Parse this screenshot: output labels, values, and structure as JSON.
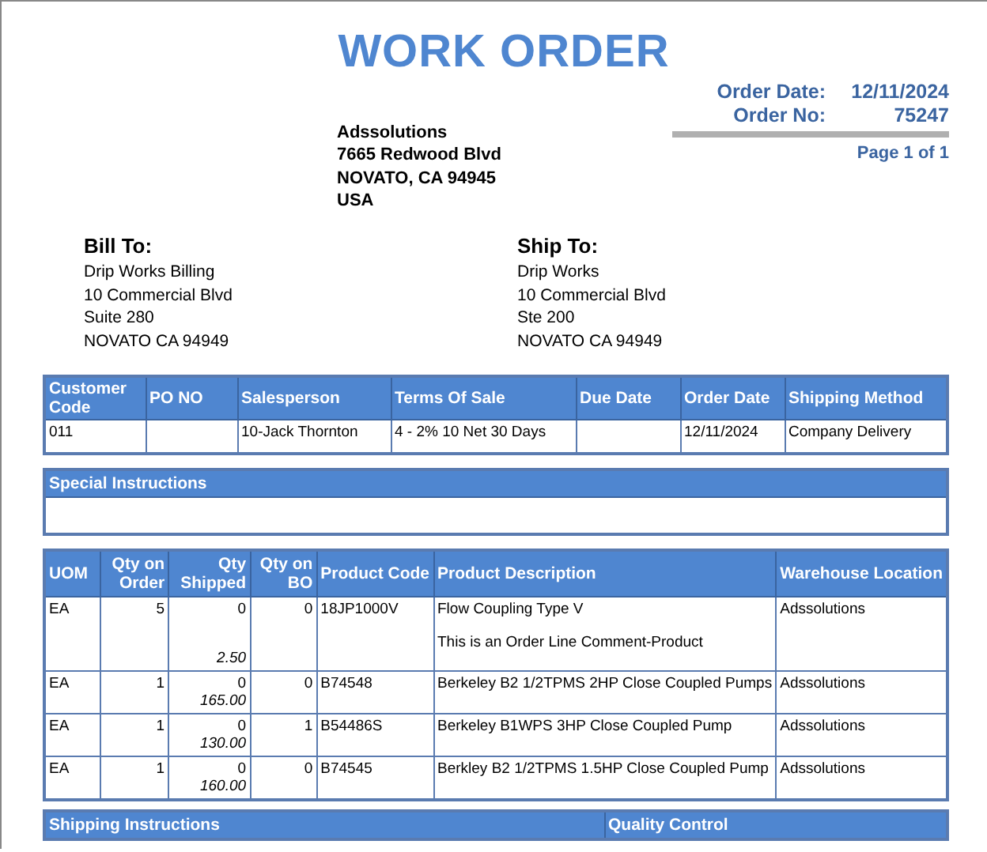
{
  "title": "WORK ORDER",
  "order_info": [
    {
      "label": "Order Date:",
      "value": "12/11/2024"
    },
    {
      "label": "Order No:",
      "value": "75247"
    }
  ],
  "page": "Page 1 of 1",
  "company": [
    "Adssolutions",
    "7665 Redwood Blvd",
    "NOVATO, CA 94945",
    "USA"
  ],
  "bill_to": {
    "heading": "Bill To:",
    "lines": [
      "Drip Works Billing",
      "10 Commercial Blvd",
      "Suite 280",
      "NOVATO CA 94949"
    ]
  },
  "ship_to": {
    "heading": "Ship To:",
    "lines": [
      "Drip Works",
      "10 Commercial Blvd",
      "Ste 200",
      "NOVATO CA 94949"
    ]
  },
  "order_table": {
    "columns": [
      "Customer Code",
      "PO NO",
      "Salesperson",
      "Terms Of Sale",
      "Due Date",
      "Order Date",
      "Shipping Method"
    ],
    "row": {
      "customer_code": "011",
      "salesperson": "10-Jack Thornton",
      "terms_of_sale": "4 - 2% 10 Net 30 Days",
      "order_date": "12/11/2024",
      "shipping_method": "Company Delivery"
    }
  },
  "special_instructions": {
    "heading": "Special Instructions"
  },
  "items_table": {
    "columns": [
      "UOM",
      "Qty on Order",
      "Qty Shipped",
      "Qty on BO",
      "Product Code",
      "Product Description",
      "Warehouse Location"
    ],
    "rows": [
      {
        "uom": "EA",
        "qty_order": "5",
        "qty_shipped": "0",
        "price": "2.50",
        "qty_bo": "0",
        "code": "18JP1000V",
        "description": "Flow Coupling Type V",
        "comment": "This is an Order Line Comment-Product",
        "warehouse": "Adssolutions"
      },
      {
        "uom": "EA",
        "qty_order": "1",
        "qty_shipped": "0",
        "price": "165.00",
        "qty_bo": "0",
        "code": "B74548",
        "description": "Berkeley B2 1/2TPMS 2HP Close Coupled Pumps",
        "warehouse": "Adssolutions"
      },
      {
        "uom": "EA",
        "qty_order": "1",
        "qty_shipped": "0",
        "price": "130.00",
        "qty_bo": "1",
        "code": "B54486S",
        "description": "Berkeley B1WPS 3HP Close Coupled Pump",
        "warehouse": "Adssolutions"
      },
      {
        "uom": "EA",
        "qty_order": "1",
        "qty_shipped": "0",
        "price": "160.00",
        "qty_bo": "0",
        "code": "B74545",
        "description": "Berkley B2 1/2TPMS 1.5HP Close Coupled Pump",
        "warehouse": "Adssolutions"
      }
    ]
  },
  "footer_sections": [
    "Shipping Instructions",
    "Quality Control"
  ]
}
